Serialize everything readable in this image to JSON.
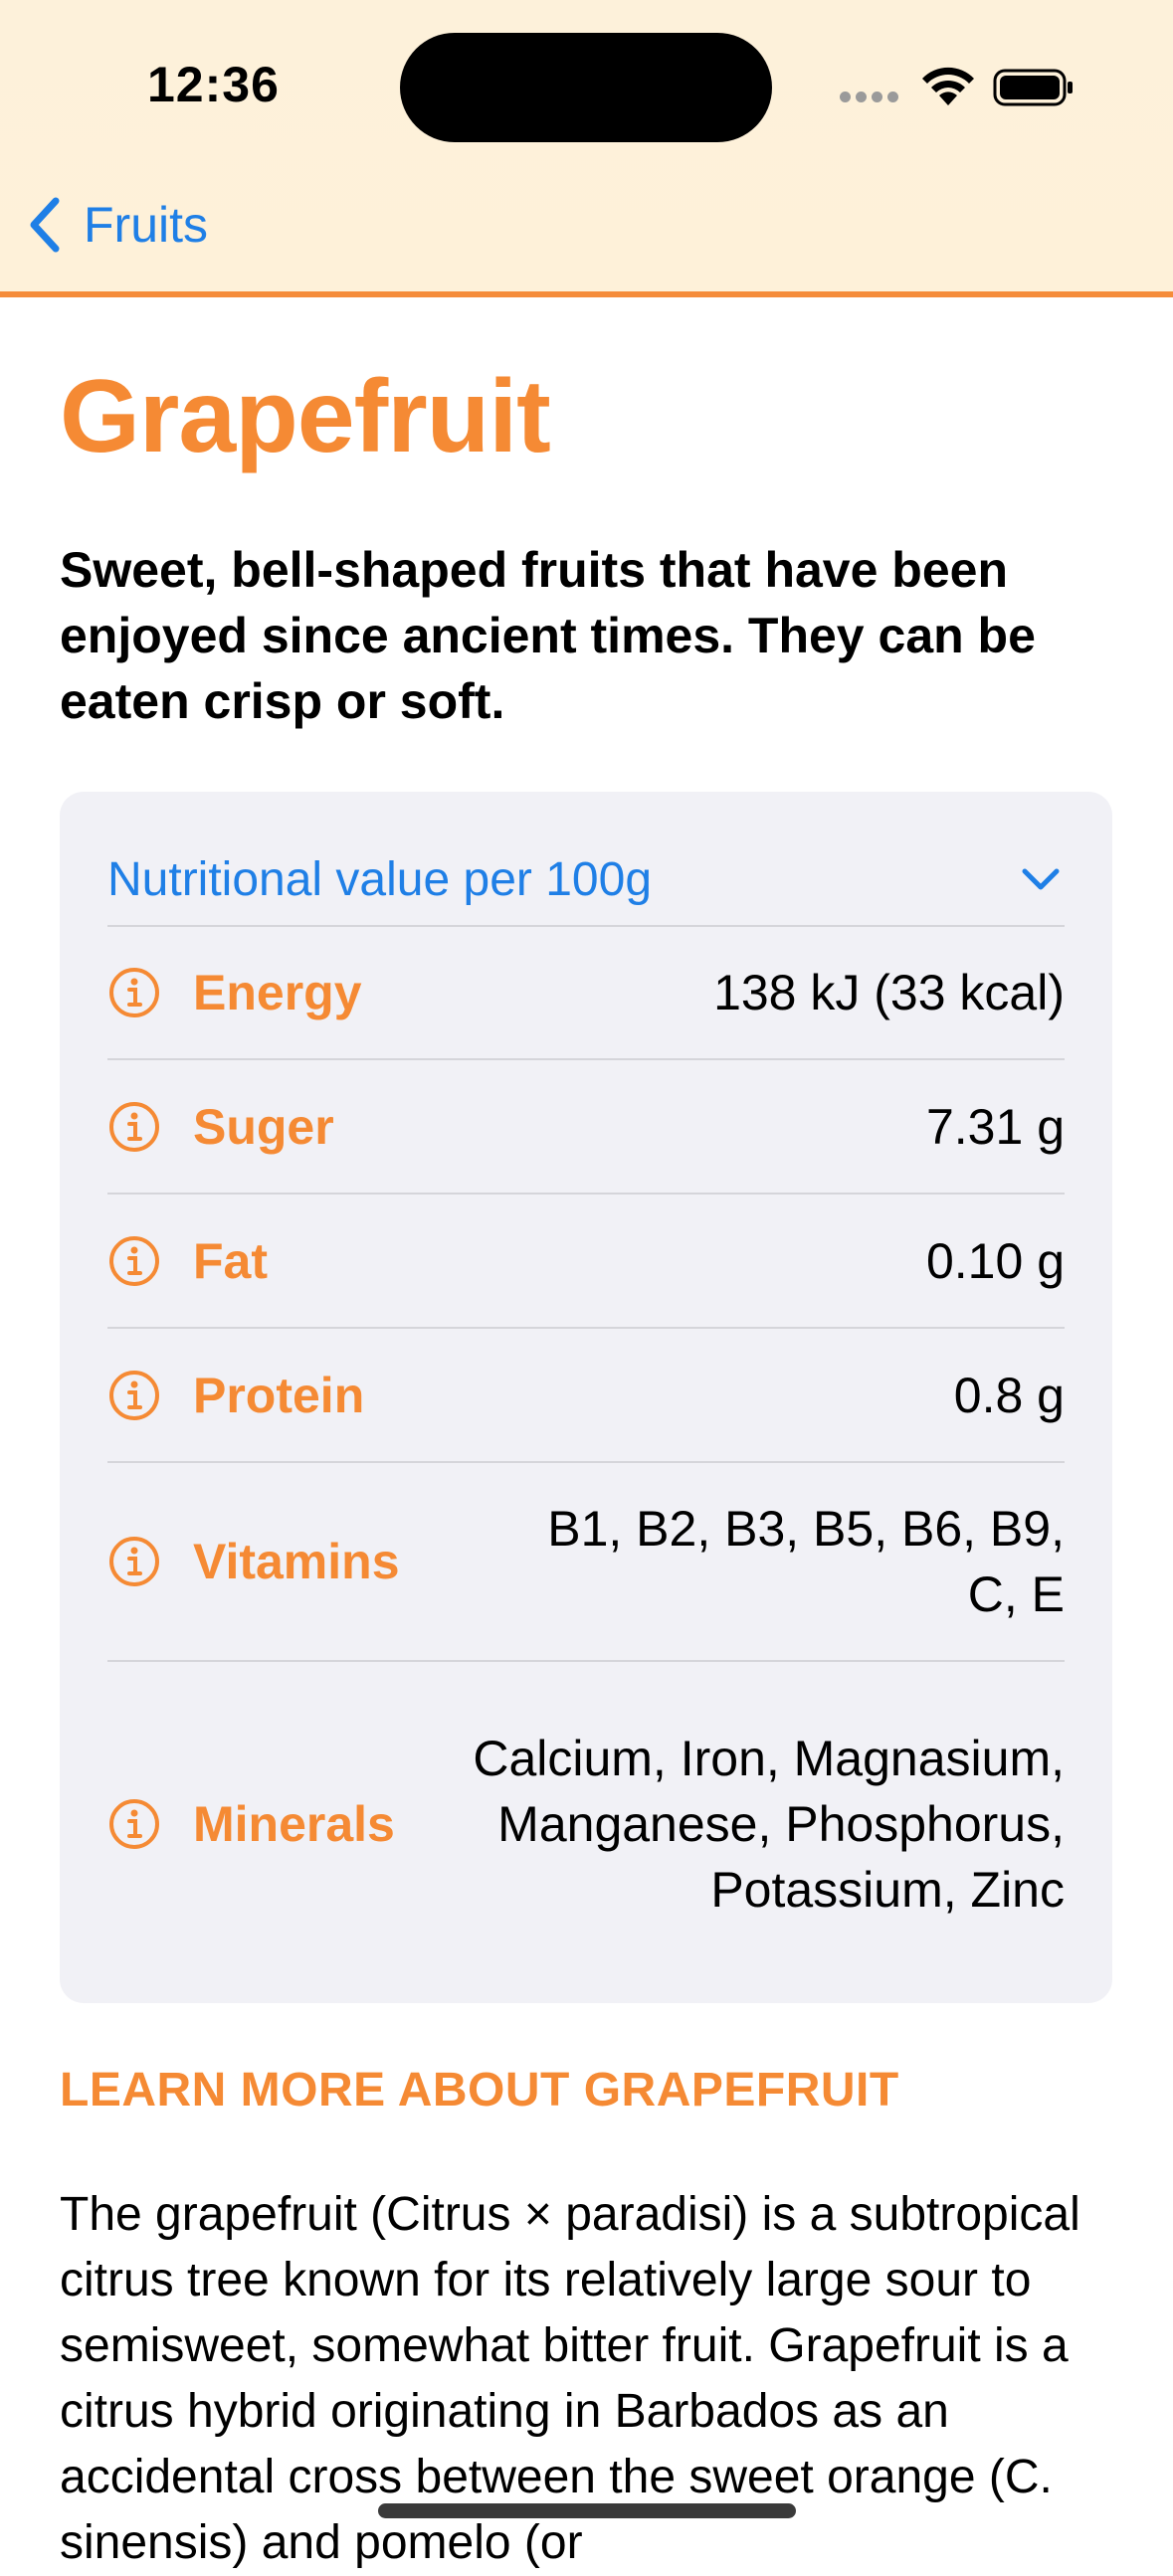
{
  "status_bar": {
    "time": "12:36"
  },
  "nav": {
    "back_label": "Fruits"
  },
  "page": {
    "title": "Grapefruit",
    "subtitle": "Sweet, bell-shaped fruits that have been enjoyed since ancient times. They can be eaten crisp or soft."
  },
  "nutrition": {
    "header": "Nutritional value per 100g",
    "rows": [
      {
        "label": "Energy",
        "value": "138 kJ (33 kcal)"
      },
      {
        "label": "Suger",
        "value": "7.31 g"
      },
      {
        "label": "Fat",
        "value": "0.10 g"
      },
      {
        "label": "Protein",
        "value": "0.8 g"
      },
      {
        "label": "Vitamins",
        "value": "B1, B2, B3, B5, B6, B9, C, E"
      },
      {
        "label": "Minerals",
        "value": "Calcium, Iron, Magnasium, Manganese, Phosphorus, Potassium, Zinc"
      }
    ]
  },
  "learn_more": {
    "heading": "LEARN MORE ABOUT GRAPEFRUIT",
    "body": "The grapefruit (Citrus × paradisi) is a subtropical citrus tree known for its relatively large sour to semisweet, somewhat bitter fruit. Grapefruit is a citrus hybrid originating in Barbados as an accidental cross between the sweet orange (C. sinensis) and pomelo (or"
  },
  "colors": {
    "accent": "#f58a34",
    "link": "#1f7fe6",
    "header_bg": "#fdf1da",
    "card_bg": "#f1f1f6"
  },
  "icons": [
    "chevron-left-icon",
    "chevron-down-icon",
    "info-circle-icon",
    "wifi-icon",
    "battery-icon",
    "signal-icon"
  ]
}
